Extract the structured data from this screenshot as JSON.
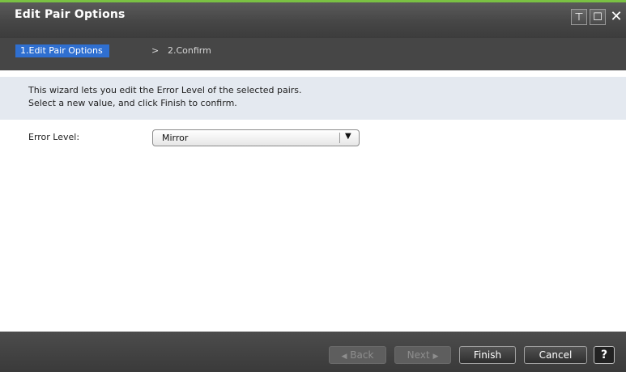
{
  "window": {
    "title": "Edit Pair Options",
    "controls": {
      "pin_icon": "⊤",
      "maximize_icon": "☐",
      "close_icon": "✕"
    }
  },
  "breadcrumb": {
    "active_step": "1.Edit Pair Options",
    "separator": ">",
    "next_step": "2.Confirm"
  },
  "info": {
    "line1": "This wizard lets you edit the Error Level of the selected pairs.",
    "line2": "Select a new value, and click Finish to confirm."
  },
  "form": {
    "error_level_label": "Error Level:",
    "error_level_value": "Mirror",
    "dropdown_arrow": "▼"
  },
  "footer": {
    "back_arrow": "◀",
    "back_label": "Back",
    "next_label": "Next",
    "next_arrow": "▶",
    "finish_label": "Finish",
    "cancel_label": "Cancel",
    "help_label": "?"
  }
}
